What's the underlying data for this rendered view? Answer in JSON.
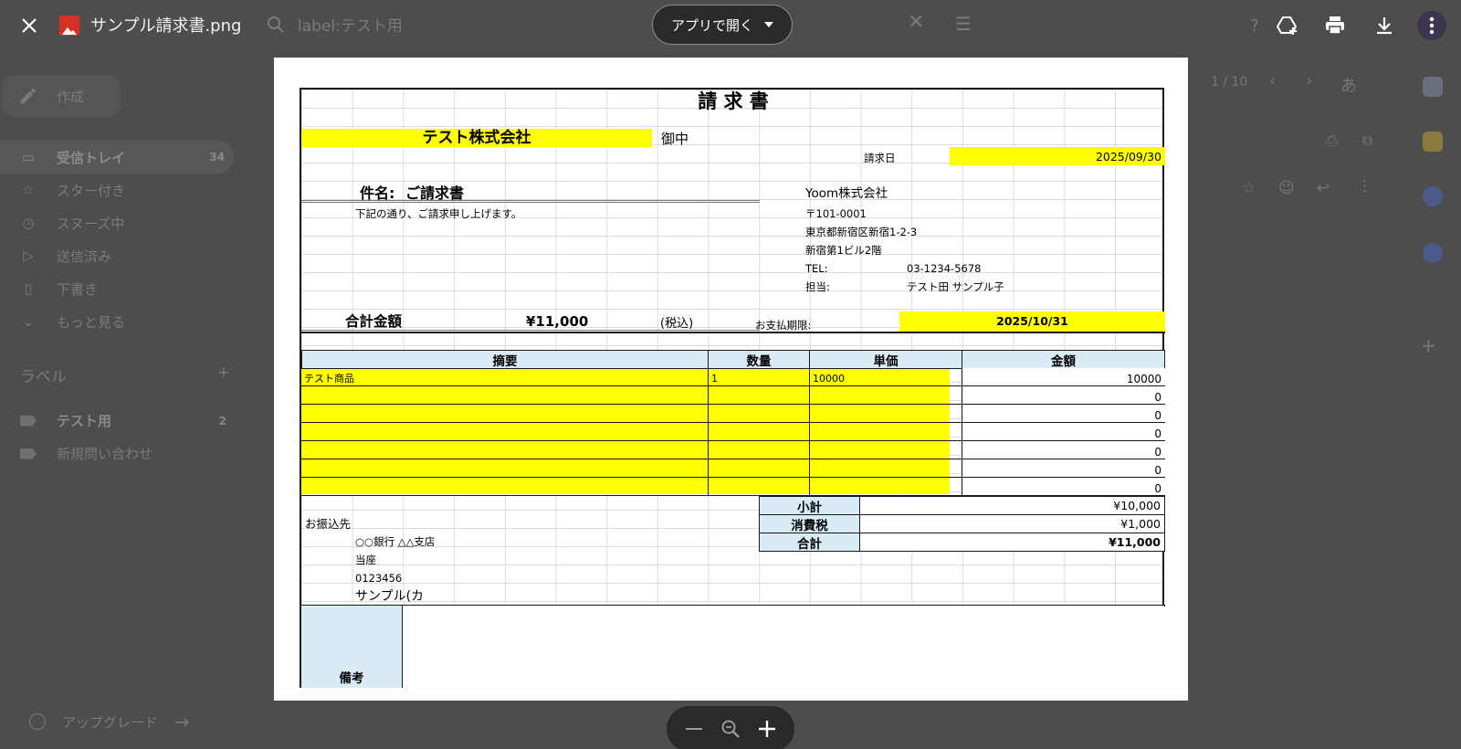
{
  "viewer": {
    "file_name": "サンプル請求書.png",
    "open_with_label": "アプリで開く",
    "icons": [
      "close-icon",
      "image-file-icon",
      "chevron-down-icon",
      "add-to-drive-icon",
      "print-icon",
      "download-icon",
      "more-vert-icon",
      "zoom-out-icon",
      "zoom-reset-icon",
      "zoom-in-icon"
    ],
    "colors": {
      "backdrop": "#4d4d4d",
      "toolbar": "#2a2a2a",
      "file_icon": "#d93025",
      "highlight": "#ffff00",
      "header_fill": "#d9ecf5"
    }
  },
  "background": {
    "search_query": "label:テスト用",
    "compose_label": "作成",
    "nav": [
      {
        "label": "受信トレイ",
        "count": "34",
        "icon": "inbox-icon"
      },
      {
        "label": "スター付き",
        "count": "",
        "icon": "star-icon"
      },
      {
        "label": "スヌーズ中",
        "count": "",
        "icon": "clock-icon"
      },
      {
        "label": "送信済み",
        "count": "",
        "icon": "send-icon"
      },
      {
        "label": "下書き",
        "count": "",
        "icon": "draft-icon"
      },
      {
        "label": "もっと見る",
        "count": "",
        "icon": "chevron-down-icon"
      }
    ],
    "labels_heading": "ラベル",
    "labels": [
      {
        "label": "テスト用",
        "count": "2"
      },
      {
        "label": "新規問い合わせ",
        "count": ""
      }
    ],
    "upgrade_label": "アップグレード",
    "pager": "1 / 10",
    "input_tool": "あ"
  },
  "invoice": {
    "title": "請 求 書",
    "recipient": "テスト株式会社",
    "honorific": "御中",
    "invoice_date_label": "請求日",
    "invoice_date": "2025/09/30",
    "subject_label": "件名:",
    "subject": "ご請求書",
    "intro": "下記の通り、ご請求申し上げます。",
    "issuer": {
      "company": "Yoom株式会社",
      "postal": "〒101-0001",
      "address1": "東京都新宿区新宿1-2-3",
      "address2": "新宿第1ビル2階",
      "tel_label": "TEL:",
      "tel": "03-1234-5678",
      "contact_label": "担当:",
      "contact": "テスト田 サンプル子"
    },
    "total_label": "合計金額",
    "total_amount": "¥11,000",
    "tax_note": "(税込)",
    "due_label": "お支払期限:",
    "due_date": "2025/10/31",
    "columns": [
      "摘要",
      "数量",
      "単価",
      "金額"
    ],
    "items": [
      {
        "desc": "テスト商品",
        "qty": "1",
        "price": "10000",
        "amount": "10000"
      },
      {
        "desc": "",
        "qty": "",
        "price": "",
        "amount": "0"
      },
      {
        "desc": "",
        "qty": "",
        "price": "",
        "amount": "0"
      },
      {
        "desc": "",
        "qty": "",
        "price": "",
        "amount": "0"
      },
      {
        "desc": "",
        "qty": "",
        "price": "",
        "amount": "0"
      },
      {
        "desc": "",
        "qty": "",
        "price": "",
        "amount": "0"
      },
      {
        "desc": "",
        "qty": "",
        "price": "",
        "amount": "0"
      }
    ],
    "subtotal_label": "小計",
    "subtotal": "¥10,000",
    "tax_label": "消費税",
    "tax": "¥1,000",
    "grand_total_label": "合計",
    "grand_total": "¥11,000",
    "bank_heading": "お振込先",
    "bank_name": "○○銀行 △△支店",
    "account_type": "当座",
    "account_number": "0123456",
    "account_holder": "サンプル(カ",
    "remarks_label": "備考"
  }
}
